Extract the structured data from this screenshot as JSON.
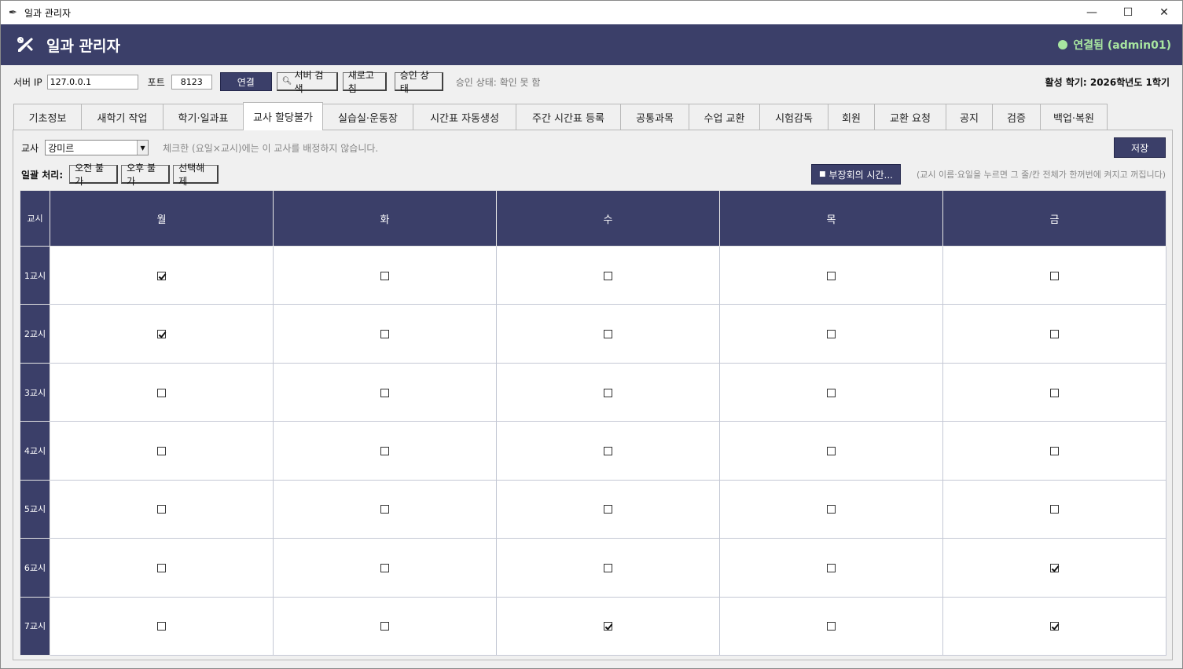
{
  "window": {
    "title": "일과 관리자",
    "minimize": "—",
    "maximize": "☐",
    "close": "✕"
  },
  "header": {
    "title": "일과 관리자",
    "status": "연결됨 (admin01)"
  },
  "toolbar": {
    "server_ip_label": "서버 IP",
    "server_ip_value": "127.0.0.1",
    "port_label": "포트",
    "port_value": "8123",
    "connect": "연결",
    "search_server": "서버 검색",
    "refresh": "새로고침",
    "approval_status_btn": "승인 상태",
    "approval_status_text": "승인 상태: 확인 못 함",
    "active_semester": "활성 학기: 2026학년도 1학기"
  },
  "tabs": [
    {
      "label": "기초정보"
    },
    {
      "label": "새학기 작업"
    },
    {
      "label": "학기·일과표"
    },
    {
      "label": "교사 할당불가"
    },
    {
      "label": "실습실·운동장"
    },
    {
      "label": "시간표 자동생성"
    },
    {
      "label": "주간 시간표 등록"
    },
    {
      "label": "공통과목"
    },
    {
      "label": "수업 교환"
    },
    {
      "label": "시험감독"
    },
    {
      "label": "회원"
    },
    {
      "label": "교환 요청"
    },
    {
      "label": "공지"
    },
    {
      "label": "검증"
    },
    {
      "label": "백업·복원"
    }
  ],
  "panel": {
    "teacher_label": "교사",
    "teacher_value": "강미르",
    "hint": "체크한 (요일×교시)에는 이 교사를 배정하지 않습니다.",
    "save": "저장",
    "bulk_label": "일괄 처리:",
    "am_unavailable": "오전 불가",
    "pm_unavailable": "오후 불가",
    "clear_selection": "선택해제",
    "meeting_time": "부장회의 시간...",
    "toggle_hint": "(교시 이름·요일을 누르면 그 줄/칸 전체가 한꺼번에 켜지고 꺼집니다)"
  },
  "grid": {
    "corner": "교시",
    "days": [
      "월",
      "화",
      "수",
      "목",
      "금"
    ],
    "periods": [
      "1교시",
      "2교시",
      "3교시",
      "4교시",
      "5교시",
      "6교시",
      "7교시"
    ],
    "checked": [
      [
        true,
        false,
        false,
        false,
        false
      ],
      [
        true,
        false,
        false,
        false,
        false
      ],
      [
        false,
        false,
        false,
        false,
        false
      ],
      [
        false,
        false,
        false,
        false,
        false
      ],
      [
        false,
        false,
        false,
        false,
        false
      ],
      [
        false,
        false,
        false,
        false,
        true
      ],
      [
        false,
        false,
        true,
        false,
        true
      ]
    ]
  }
}
